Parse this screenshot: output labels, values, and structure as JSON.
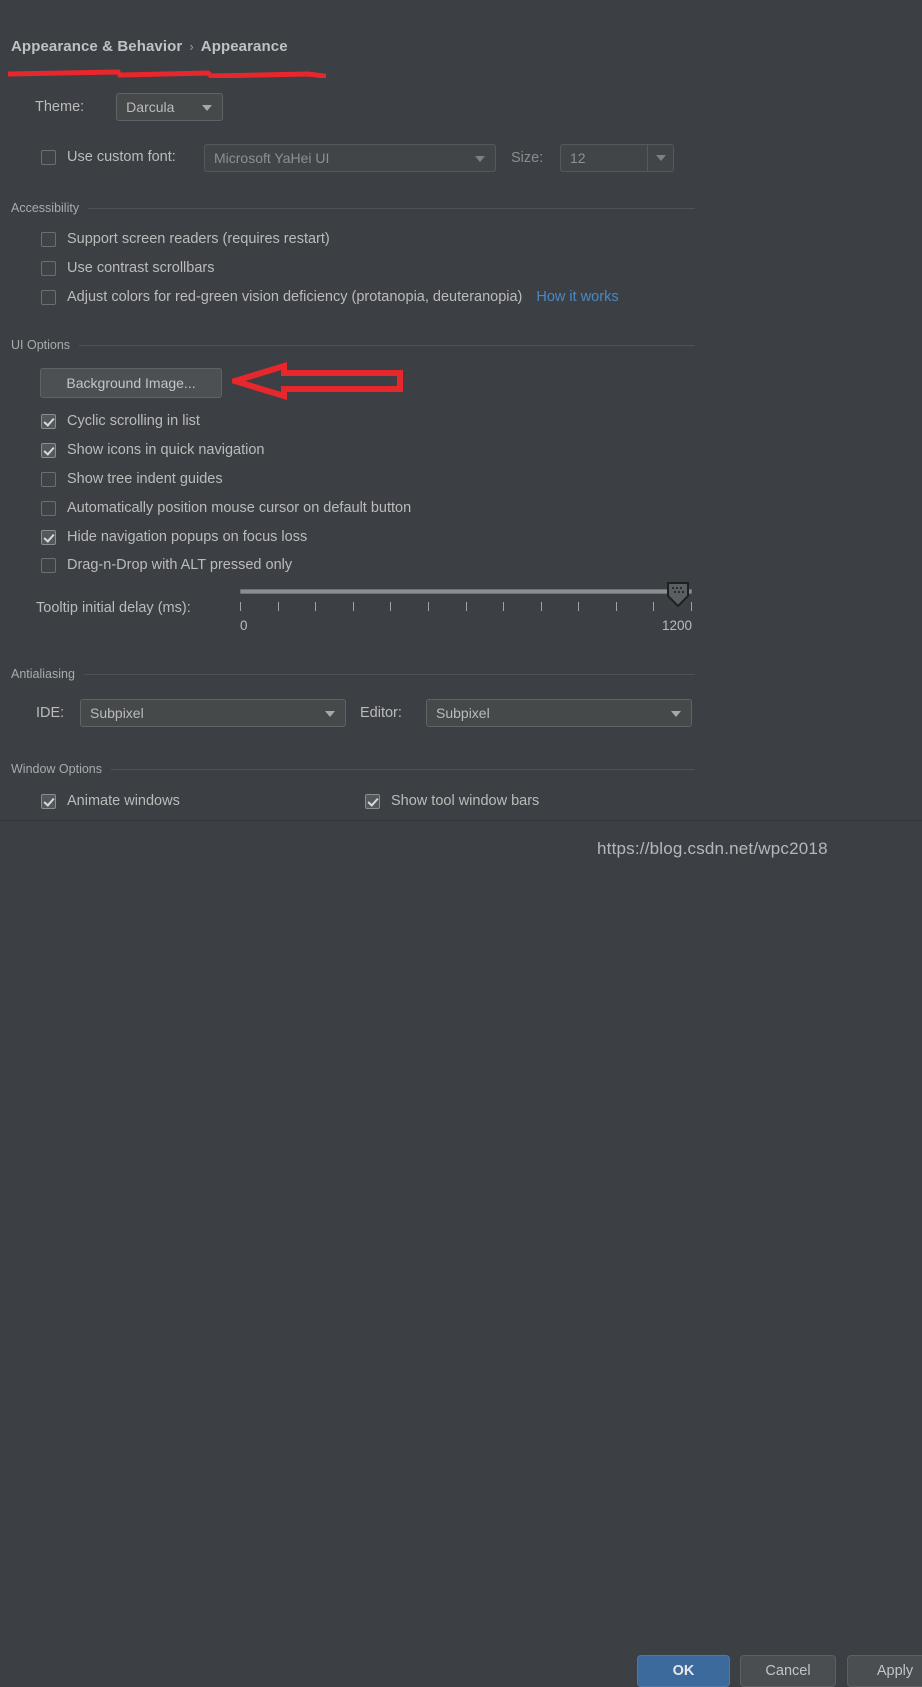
{
  "breadcrumb": {
    "root": "Appearance & Behavior",
    "separator": "›",
    "current": "Appearance"
  },
  "theme": {
    "label": "Theme:",
    "value": "Darcula"
  },
  "custom_font": {
    "checkbox_label": "Use custom font:",
    "checked": false,
    "font_value": "Microsoft YaHei UI",
    "size_label": "Size:",
    "size_value": "12"
  },
  "accessibility": {
    "title": "Accessibility",
    "items": [
      {
        "label": "Support screen readers (requires restart)",
        "checked": false
      },
      {
        "label": "Use contrast scrollbars",
        "checked": false
      },
      {
        "label": "Adjust colors for red-green vision deficiency (protanopia, deuteranopia)",
        "checked": false
      }
    ],
    "link": "How it works"
  },
  "ui_options": {
    "title": "UI Options",
    "background_image_button": "Background Image...",
    "items": [
      {
        "label": "Cyclic scrolling in list",
        "checked": true
      },
      {
        "label": "Show icons in quick navigation",
        "checked": true
      },
      {
        "label": "Show tree indent guides",
        "checked": false
      },
      {
        "label": "Automatically position mouse cursor on default button",
        "checked": false
      },
      {
        "label": "Hide navigation popups on focus loss",
        "checked": true
      },
      {
        "label": "Drag-n-Drop with ALT pressed only",
        "checked": false
      }
    ],
    "tooltip_delay": {
      "label": "Tooltip initial delay (ms):",
      "min": "0",
      "max": "1200",
      "value": 1200,
      "tick_count": 13
    }
  },
  "antialiasing": {
    "title": "Antialiasing",
    "ide_label": "IDE:",
    "ide_value": "Subpixel",
    "editor_label": "Editor:",
    "editor_value": "Subpixel"
  },
  "window_options": {
    "title": "Window Options",
    "items": [
      {
        "label": "Animate windows",
        "checked": true
      },
      {
        "label": "Show tool window bars",
        "checked": true
      }
    ]
  },
  "dialog_buttons": {
    "ok": "OK",
    "cancel": "Cancel",
    "apply": "Apply"
  },
  "watermark": {
    "text": "https://blog.csdn.net/wpc2018"
  },
  "colors": {
    "background": "#3c4044",
    "accent_blue": "#3c6a9c",
    "link_blue": "#4a88c7",
    "annotation_red": "#e8272c"
  }
}
